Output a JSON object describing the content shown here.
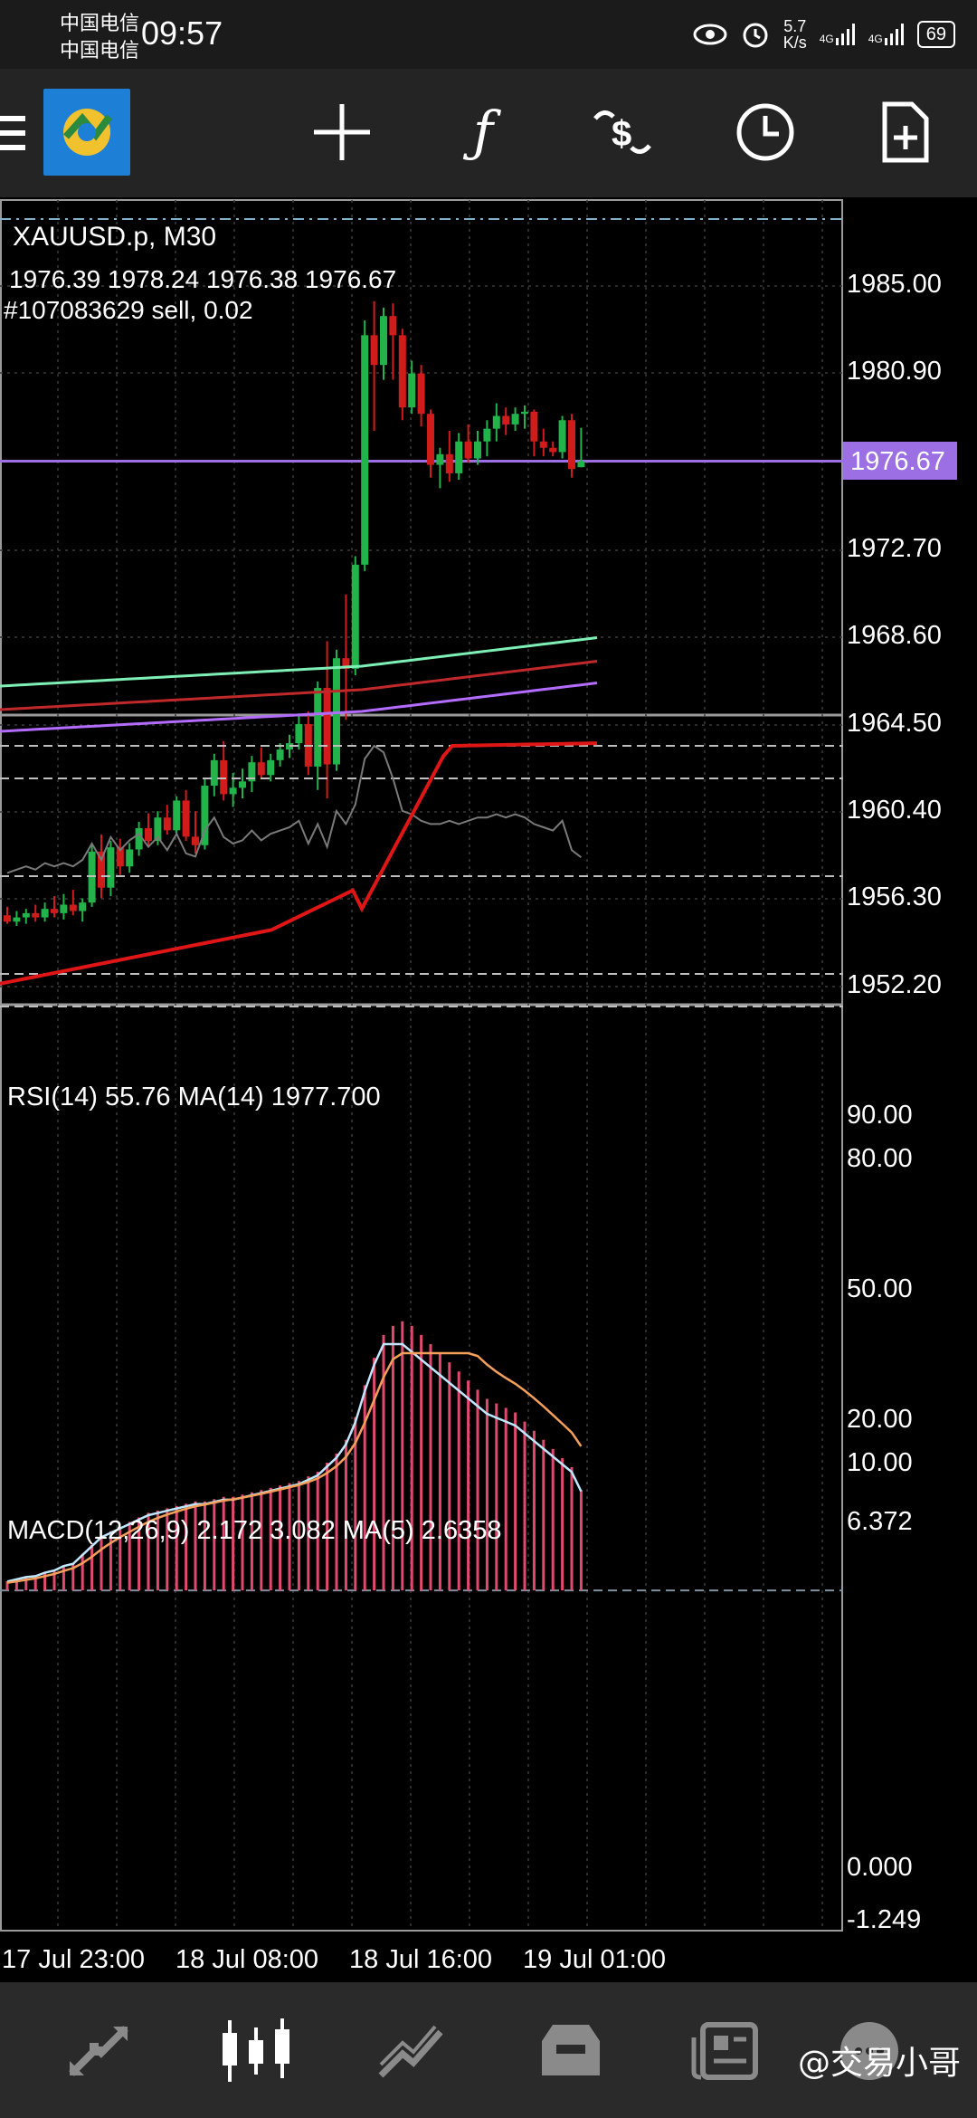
{
  "status_bar": {
    "carrier1": "中国电信",
    "carrier2": "中国电信",
    "time": "09:57",
    "net_speed_value": "5.7",
    "net_speed_unit": "K/s",
    "sig1": "4G",
    "sig2": "4G",
    "battery": "69"
  },
  "toolbar": {
    "app_icon": "metatrader-4-icon",
    "icons": [
      "crosshair-icon",
      "indicator-f-icon",
      "trade-dollar-icon",
      "period-clock-icon",
      "new-order-icon"
    ]
  },
  "chart": {
    "symbol_title": "XAUUSD.p, M30",
    "ohlc": "1976.39 1978.24 1976.38 1976.67",
    "order_label": "#107083629 sell, 0.02",
    "current_price": "1976.67",
    "price_axis": [
      "1985.00",
      "1980.90",
      "1972.70",
      "1968.60",
      "1964.50",
      "1960.40",
      "1956.30",
      "1952.20"
    ],
    "time_axis": [
      "17 Jul 23:00",
      "18 Jul 08:00",
      "18 Jul 16:00",
      "19 Jul 01:00"
    ],
    "colors": {
      "bull": "#22b34a",
      "bear": "#d11c1c",
      "price_line": "#9c6fe4",
      "rsi_ma": "#e01515",
      "macd_line": "#bfe8ff",
      "macd_signal": "#f4a05a",
      "macd_hist": "#e14a6e",
      "ma1": "#7ef0b6",
      "ma2": "#c0282a",
      "ma3": "#b36cff"
    }
  },
  "rsi": {
    "label": "RSI(14) 55.76 MA(14) 1977.700",
    "levels": [
      "90.00",
      "80.00",
      "50.00",
      "20.00",
      "10.00"
    ]
  },
  "macd": {
    "label": "MACD(12,26,9) 2.172 3.082 MA(5) 2.6358",
    "top": "6.372",
    "zero": "0.000",
    "bottom": "-1.249"
  },
  "bottom_nav": {
    "items": [
      "quotes-icon",
      "chart-icon",
      "trade-icon",
      "history-icon",
      "news-icon",
      "chat-icon"
    ]
  },
  "watermark": "@交易小哥"
}
